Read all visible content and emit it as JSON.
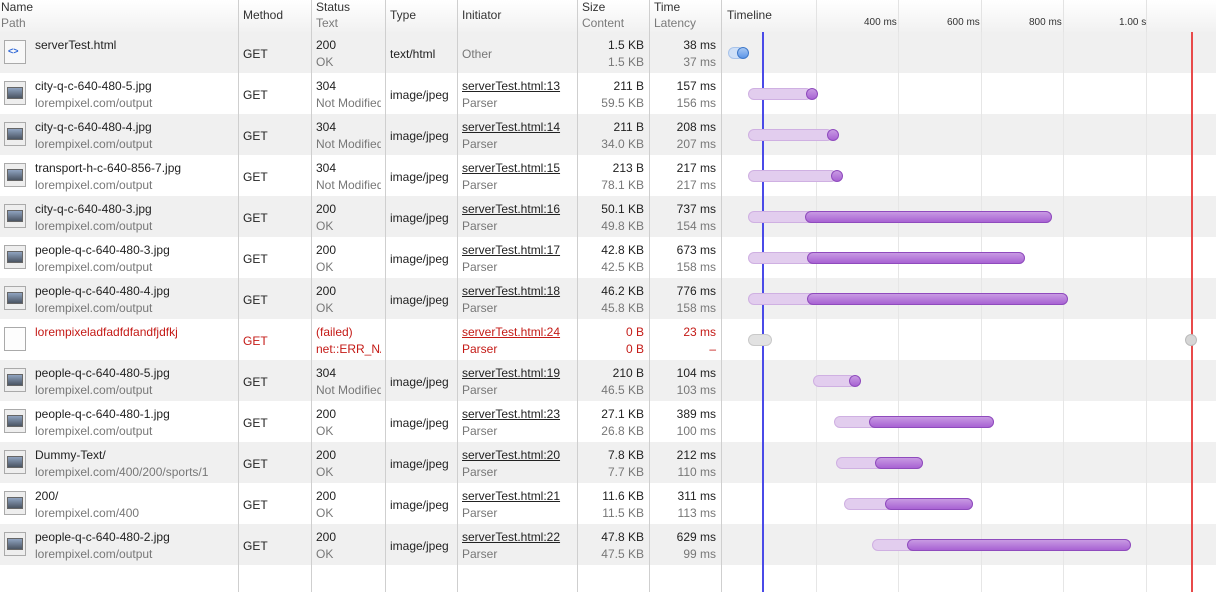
{
  "headers": {
    "name": "Name",
    "path": "Path",
    "method": "Method",
    "status": "Status",
    "status_text": "Text",
    "type": "Type",
    "initiator": "Initiator",
    "size": "Size",
    "content": "Content",
    "time": "Time",
    "latency": "Latency",
    "timeline": "Timeline"
  },
  "timeline_ticks": [
    "400 ms",
    "600 ms",
    "800 ms",
    "1.00 s"
  ],
  "colors": {
    "failed_text": "#c41a16",
    "dom_content_loaded_line": "#4a4ae8",
    "load_line": "#e84a4a",
    "receive_bar": "#a863d3",
    "wait_bar": "#e2cdee",
    "html_bar": "#5c96e8"
  },
  "rows": [
    {
      "name": "serverTest.html",
      "path": "",
      "icon": "html-doc-icon",
      "method": "GET",
      "status": "200",
      "status_text": "OK",
      "type": "text/html",
      "initiator": "Other",
      "initiator_sub": "",
      "initiator_link": false,
      "size": "1.5 KB",
      "content": "1.5 KB",
      "time": "38 ms",
      "latency": "37 ms",
      "failed": false
    },
    {
      "name": "city-q-c-640-480-5.jpg",
      "path": "lorempixel.com/output",
      "icon": "image-thumb-icon",
      "method": "GET",
      "status": "304",
      "status_text": "Not Modified",
      "type": "image/jpeg",
      "initiator": "serverTest.html:13",
      "initiator_sub": "Parser",
      "initiator_link": true,
      "size": "211 B",
      "content": "59.5 KB",
      "time": "157 ms",
      "latency": "156 ms",
      "failed": false
    },
    {
      "name": "city-q-c-640-480-4.jpg",
      "path": "lorempixel.com/output",
      "icon": "image-thumb-icon",
      "method": "GET",
      "status": "304",
      "status_text": "Not Modified",
      "type": "image/jpeg",
      "initiator": "serverTest.html:14",
      "initiator_sub": "Parser",
      "initiator_link": true,
      "size": "211 B",
      "content": "34.0 KB",
      "time": "208 ms",
      "latency": "207 ms",
      "failed": false
    },
    {
      "name": "transport-h-c-640-856-7.jpg",
      "path": "lorempixel.com/output",
      "icon": "image-thumb-icon",
      "method": "GET",
      "status": "304",
      "status_text": "Not Modified",
      "type": "image/jpeg",
      "initiator": "serverTest.html:15",
      "initiator_sub": "Parser",
      "initiator_link": true,
      "size": "213 B",
      "content": "78.1 KB",
      "time": "217 ms",
      "latency": "217 ms",
      "failed": false
    },
    {
      "name": "city-q-c-640-480-3.jpg",
      "path": "lorempixel.com/output",
      "icon": "image-thumb-icon",
      "method": "GET",
      "status": "200",
      "status_text": "OK",
      "type": "image/jpeg",
      "initiator": "serverTest.html:16",
      "initiator_sub": "Parser",
      "initiator_link": true,
      "size": "50.1 KB",
      "content": "49.8 KB",
      "time": "737 ms",
      "latency": "154 ms",
      "failed": false
    },
    {
      "name": "people-q-c-640-480-3.jpg",
      "path": "lorempixel.com/output",
      "icon": "image-thumb-icon",
      "method": "GET",
      "status": "200",
      "status_text": "OK",
      "type": "image/jpeg",
      "initiator": "serverTest.html:17",
      "initiator_sub": "Parser",
      "initiator_link": true,
      "size": "42.8 KB",
      "content": "42.5 KB",
      "time": "673 ms",
      "latency": "158 ms",
      "failed": false
    },
    {
      "name": "people-q-c-640-480-4.jpg",
      "path": "lorempixel.com/output",
      "icon": "image-thumb-icon",
      "method": "GET",
      "status": "200",
      "status_text": "OK",
      "type": "image/jpeg",
      "initiator": "serverTest.html:18",
      "initiator_sub": "Parser",
      "initiator_link": true,
      "size": "46.2 KB",
      "content": "45.8 KB",
      "time": "776 ms",
      "latency": "158 ms",
      "failed": false
    },
    {
      "name": "lorempixeladfadfdfandfjdfkj",
      "path": "",
      "icon": "blank-file-icon",
      "method": "GET",
      "status": "(failed)",
      "status_text": "net::ERR_NAME_NOT_RESOLVED",
      "type": "",
      "initiator": "serverTest.html:24",
      "initiator_sub": "Parser",
      "initiator_link": true,
      "size": "0 B",
      "content": "0 B",
      "time": "23 ms",
      "latency": "–",
      "failed": true
    },
    {
      "name": "people-q-c-640-480-5.jpg",
      "path": "lorempixel.com/output",
      "icon": "image-thumb-icon",
      "method": "GET",
      "status": "304",
      "status_text": "Not Modified",
      "type": "image/jpeg",
      "initiator": "serverTest.html:19",
      "initiator_sub": "Parser",
      "initiator_link": true,
      "size": "210 B",
      "content": "46.5 KB",
      "time": "104 ms",
      "latency": "103 ms",
      "failed": false
    },
    {
      "name": "people-q-c-640-480-1.jpg",
      "path": "lorempixel.com/output",
      "icon": "image-thumb-icon",
      "method": "GET",
      "status": "200",
      "status_text": "OK",
      "type": "image/jpeg",
      "initiator": "serverTest.html:23",
      "initiator_sub": "Parser",
      "initiator_link": true,
      "size": "27.1 KB",
      "content": "26.8 KB",
      "time": "389 ms",
      "latency": "100 ms",
      "failed": false
    },
    {
      "name": "Dummy-Text/",
      "path": "lorempixel.com/400/200/sports/1",
      "icon": "image-thumb-icon",
      "method": "GET",
      "status": "200",
      "status_text": "OK",
      "type": "image/jpeg",
      "initiator": "serverTest.html:20",
      "initiator_sub": "Parser",
      "initiator_link": true,
      "size": "7.8 KB",
      "content": "7.7 KB",
      "time": "212 ms",
      "latency": "110 ms",
      "failed": false
    },
    {
      "name": "200/",
      "path": "lorempixel.com/400",
      "icon": "image-thumb-icon",
      "method": "GET",
      "status": "200",
      "status_text": "OK",
      "type": "image/jpeg",
      "initiator": "serverTest.html:21",
      "initiator_sub": "Parser",
      "initiator_link": true,
      "size": "11.6 KB",
      "content": "11.5 KB",
      "time": "311 ms",
      "latency": "113 ms",
      "failed": false
    },
    {
      "name": "people-q-c-640-480-2.jpg",
      "path": "lorempixel.com/output",
      "icon": "image-thumb-icon",
      "method": "GET",
      "status": "200",
      "status_text": "OK",
      "type": "image/jpeg",
      "initiator": "serverTest.html:22",
      "initiator_sub": "Parser",
      "initiator_link": true,
      "size": "47.8 KB",
      "content": "47.5 KB",
      "time": "629 ms",
      "latency": "99 ms",
      "failed": false
    }
  ]
}
